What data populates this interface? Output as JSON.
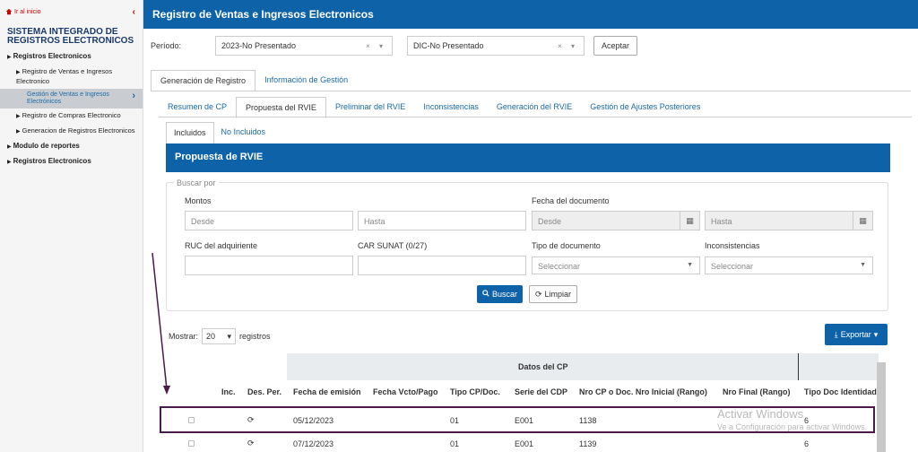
{
  "sidebar": {
    "back_label": "Ir al inicio",
    "system_title": "SISTEMA INTEGRADO DE REGISTROS ELECTRONICOS",
    "items": [
      {
        "label": "Registros Electronicos"
      },
      {
        "label": "Registro de Ventas e Ingresos Electronico"
      },
      {
        "label": "Gestión de Ventas e Ingresos Electrónicos"
      },
      {
        "label": "Registro de Compras Electronico"
      },
      {
        "label": "Generacion de Registros Electronicos"
      },
      {
        "label": "Modulo de reportes"
      },
      {
        "label": "Registros Electronicos"
      }
    ]
  },
  "header": {
    "title": "Registro de Ventas e Ingresos Electronicos"
  },
  "period": {
    "label": "Período:",
    "year_value": "2023-No Presentado",
    "month_value": "DIC-No Presentado",
    "accept_label": "Aceptar"
  },
  "tabs_top": [
    {
      "label": "Generación de Registro"
    },
    {
      "label": "Información de Gestión"
    }
  ],
  "tabs_mid": [
    {
      "label": "Resumen de CP"
    },
    {
      "label": "Propuesta del RVIE"
    },
    {
      "label": "Preliminar del RVIE"
    },
    {
      "label": "Inconsistencias"
    },
    {
      "label": "Generación del RVIE"
    },
    {
      "label": "Gestión de Ajustes Posteriores"
    }
  ],
  "tabs_inner": [
    {
      "label": "Incluidos"
    },
    {
      "label": "No Incluidos"
    }
  ],
  "panel_title": "Propuesta de RVIE",
  "search": {
    "legend": "Buscar por",
    "montos_label": "Montos",
    "desde_placeholder": "Desde",
    "hasta_placeholder": "Hasta",
    "fecha_label": "Fecha del documento",
    "fecha_desde": "Desde",
    "fecha_hasta": "Hasta",
    "ruc_label": "RUC del adquiriente",
    "car_label": "CAR SUNAT (0/27)",
    "tipo_label": "Tipo de documento",
    "tipo_value": "Seleccionar",
    "incons_label": "Inconsistencias",
    "incons_value": "Seleccionar",
    "buscar_label": "Buscar",
    "limpiar_label": "Limpiar"
  },
  "table": {
    "show_label": "Mostrar:",
    "page_size": "20",
    "records_label": "registros",
    "export_label": "Exportar",
    "group_header": "Datos del CP",
    "columns": [
      "Inc.",
      "Des. Per.",
      "Fecha de emisión",
      "Fecha Vcto/Pago",
      "Tipo CP/Doc.",
      "Serie del CDP",
      "Nro CP o Doc. Nro Inicial (Rango)",
      "Nro Final (Rango)",
      "Tipo Doc Identidad"
    ],
    "rows": [
      {
        "fecha": "05/12/2023",
        "tipo": "01",
        "serie": "E001",
        "nro": "1138",
        "tipo_doc": "6"
      },
      {
        "fecha": "07/12/2023",
        "tipo": "01",
        "serie": "E001",
        "nro": "1139",
        "tipo_doc": "6"
      }
    ]
  },
  "watermark": {
    "line1": "Activar Windows",
    "line2": "Ve a Configuración para activar Windows."
  }
}
